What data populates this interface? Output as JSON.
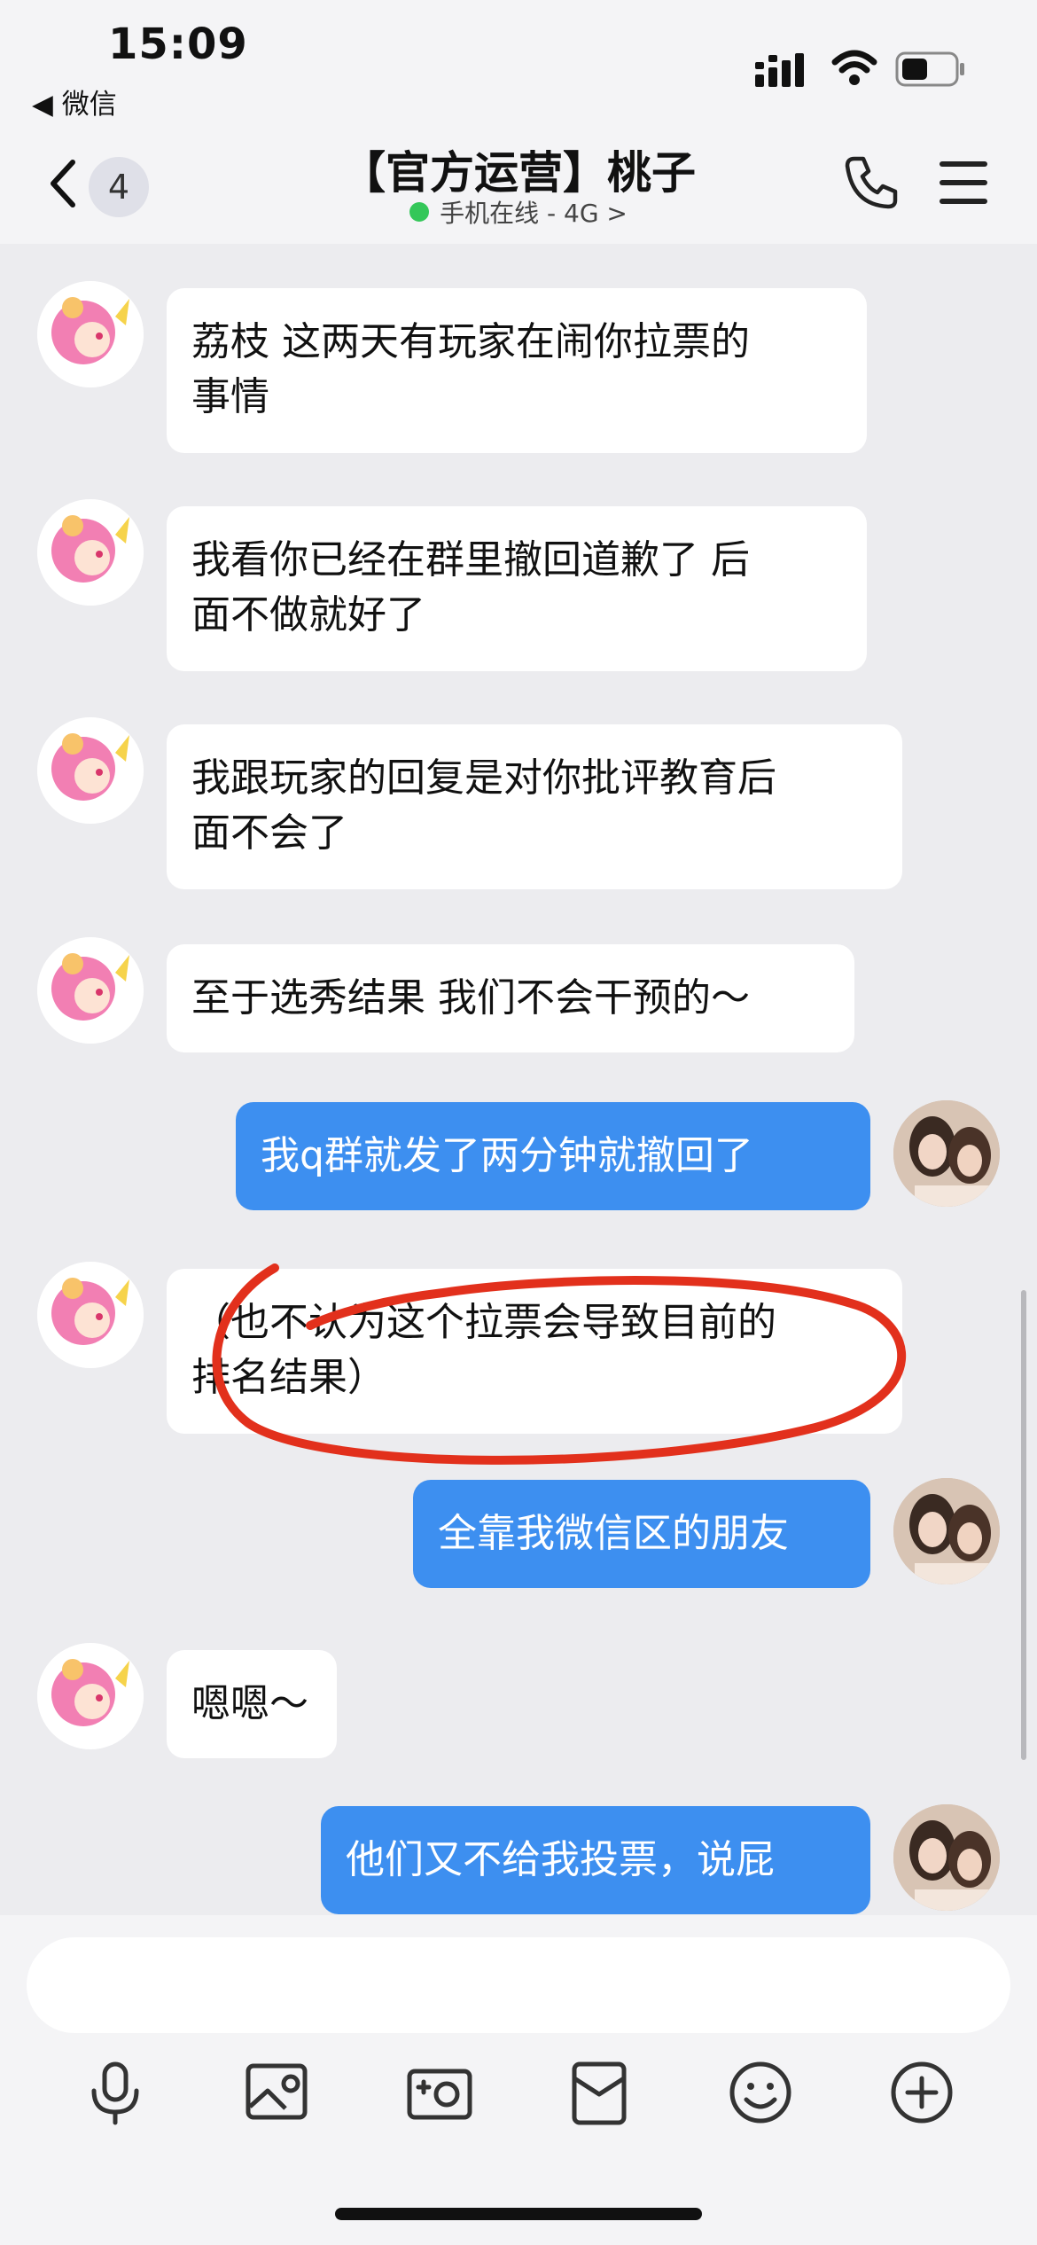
{
  "status": {
    "time": "15:09",
    "back_app": "◀ 微信"
  },
  "header": {
    "unread_count": "4",
    "title": "【官方运营】桃子",
    "subtitle": "手机在线 - 4G >"
  },
  "messages": [
    {
      "from": "peer",
      "lines": [
        "荔枝 这两天有玩家在闹你拉票的",
        "事情"
      ]
    },
    {
      "from": "peer",
      "lines": [
        "我看你已经在群里撤回道歉了 后",
        "面不做就好了"
      ]
    },
    {
      "from": "peer",
      "lines": [
        "我跟玩家的回复是对你批评教育后",
        "面不会了"
      ]
    },
    {
      "from": "peer",
      "lines": [
        "至于选秀结果 我们不会干预的～"
      ]
    },
    {
      "from": "me",
      "lines": [
        "我q群就发了两分钟就撤回了"
      ]
    },
    {
      "from": "peer",
      "lines": [
        "（也不认为这个拉票会导致目前的",
        "排名结果）"
      ]
    },
    {
      "from": "me",
      "lines": [
        "全靠我微信区的朋友"
      ]
    },
    {
      "from": "peer",
      "lines": [
        "嗯嗯～"
      ]
    },
    {
      "from": "me",
      "lines": [
        "他们又不给我投票，说屁"
      ]
    }
  ],
  "input": {
    "value": "",
    "placeholder": ""
  },
  "toolbar": [
    "mic-icon",
    "image-icon",
    "camera-icon",
    "red-packet-icon",
    "emoji-icon",
    "plus-icon"
  ],
  "colors": {
    "out_bubble": "#3d8ff0",
    "in_bubble": "#ffffff",
    "annotation": "#e2301c",
    "online": "#34c759"
  }
}
